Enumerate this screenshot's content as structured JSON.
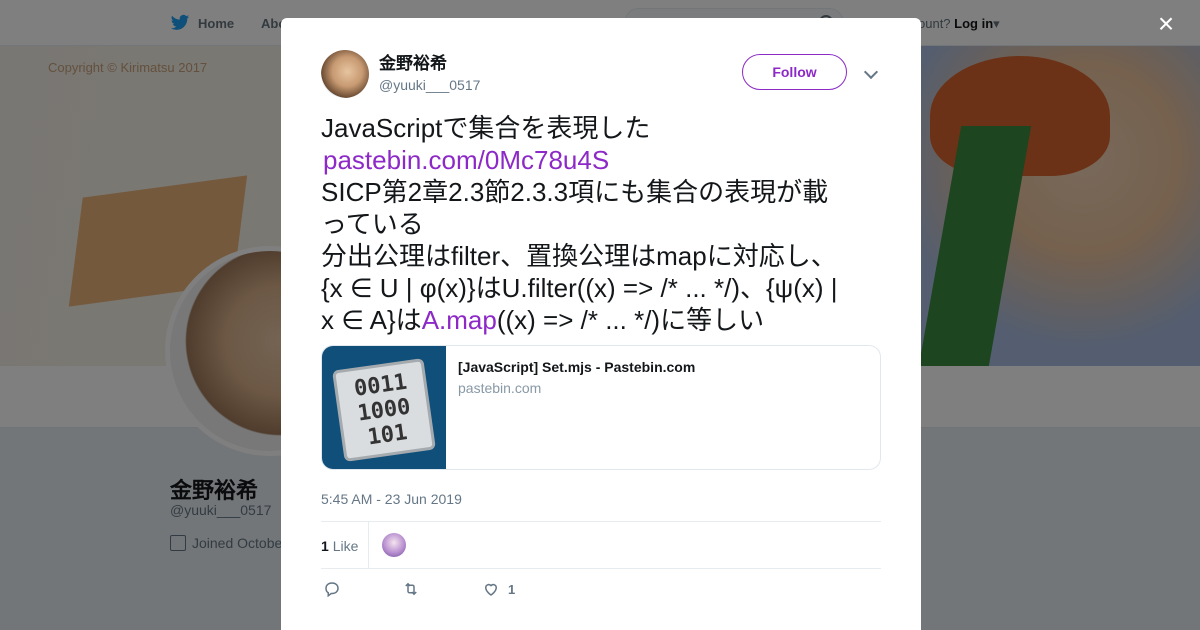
{
  "nav": {
    "home_label": "Home",
    "about_label": "Abo",
    "account_prompt": "ccount?",
    "login_label": "Log in"
  },
  "banner": {
    "copyright": "Copyright © Kirimatsu 2017"
  },
  "profile": {
    "name": "金野裕希",
    "handle": "@yuuki___0517",
    "joined": "Joined Octobe"
  },
  "modal": {
    "close_label": "×",
    "author_name": "金野裕希",
    "author_handle": "@yuuki___0517",
    "follow_label": "Follow",
    "tweet_lines": {
      "l1": "JavaScriptで集合を表現した",
      "l2_link": "pastebin.com/0Mc78u4S",
      "l3": "SICP第2章2.3節2.3.3項にも集合の表現が載",
      "l4": "っている",
      "l5": "分出公理はfilter、置換公理はmapに対応し、",
      "l6": "{x ∈ U | φ(x)}はU.filter((x) => /* ... */)、{ψ(x) |",
      "l7_pre": "x ∈ A}は",
      "l7_link": "A.map",
      "l7_post": "((x) => /* ... */)に等しい"
    },
    "card": {
      "thumb_text": "0011\n1000\n101",
      "title": "[JavaScript] Set.mjs - Pastebin.com",
      "domain": "pastebin.com"
    },
    "timestamp": "5:45 AM - 23 Jun 2019",
    "likes": {
      "count": "1",
      "label": "Like"
    },
    "actions": {
      "like_count": "1"
    }
  },
  "colors": {
    "accent": "#8c29c7",
    "twitter_blue": "#1da1f2",
    "secondary_text": "#657786"
  }
}
